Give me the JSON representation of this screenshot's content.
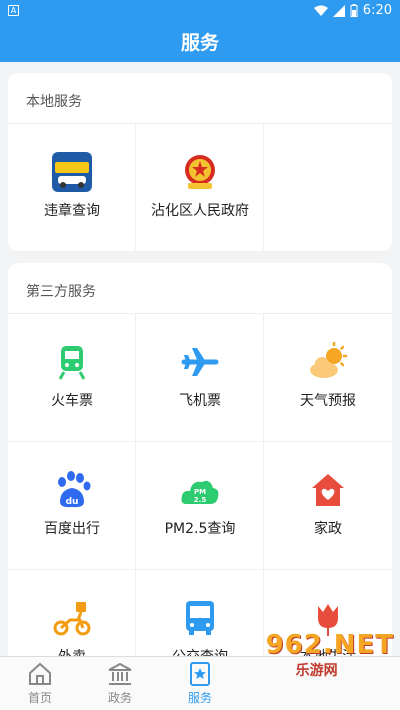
{
  "status_bar": {
    "badge": "A",
    "time": "6:20"
  },
  "header": {
    "title": "服务"
  },
  "local_section": {
    "title": "本地服务",
    "items": [
      {
        "label": "违章查询",
        "icon": "traffic-violation-icon"
      },
      {
        "label": "沾化区人民政府",
        "icon": "national-emblem-icon"
      }
    ]
  },
  "third_section": {
    "title": "第三方服务",
    "items": [
      {
        "label": "火车票",
        "icon": "train-icon"
      },
      {
        "label": "飞机票",
        "icon": "airplane-icon"
      },
      {
        "label": "天气预报",
        "icon": "weather-icon"
      },
      {
        "label": "百度出行",
        "icon": "baidu-paw-icon"
      },
      {
        "label": "PM2.5查询",
        "icon": "pm25-cloud-icon"
      },
      {
        "label": "家政",
        "icon": "home-heart-icon"
      },
      {
        "label": "外卖",
        "icon": "scooter-icon"
      },
      {
        "label": "公交查询",
        "icon": "bus-icon"
      },
      {
        "label": "本地生活",
        "icon": "tulip-icon"
      }
    ]
  },
  "bottom_nav": {
    "items": [
      {
        "label": "首页",
        "icon": "home-icon"
      },
      {
        "label": "政务",
        "icon": "government-building-icon"
      },
      {
        "label": "服务",
        "icon": "star-bookmark-icon",
        "active": true
      }
    ]
  },
  "watermark": {
    "big": "962.NET",
    "small": "乐游网"
  },
  "colors": {
    "primary": "#2f9bf0",
    "train_green": "#2ecc71",
    "weather_orange": "#f5a623",
    "home_red": "#e74c3c"
  }
}
